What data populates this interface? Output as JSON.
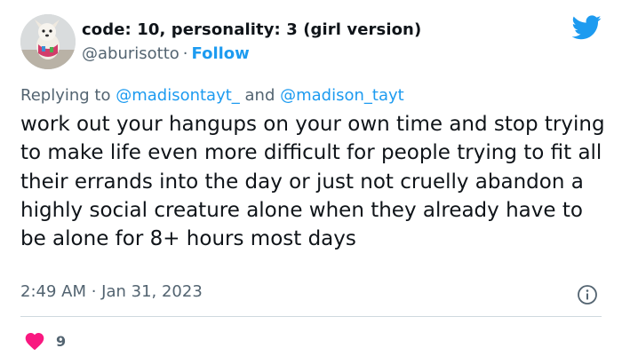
{
  "author": {
    "display_name": "code: 10, personality: 3 (girl version)",
    "handle": "@aburisotto",
    "separator": "·",
    "follow_label": "Follow"
  },
  "reply": {
    "prefix": "Replying to ",
    "mention_1": "@madisontayt_",
    "conjunction": " and ",
    "mention_2": "@madison_tayt"
  },
  "tweet": {
    "text": "work out your hangups on your own time and stop trying to make life even more difficult for people trying to fit all their errands into the day or just not cruelly abandon a highly social creature alone when they already have to be alone for 8+ hours most days",
    "timestamp": "2:49 AM · Jan 31, 2023"
  },
  "engagement": {
    "likes": "9"
  },
  "colors": {
    "accent": "#1d9bf0",
    "muted": "#536471",
    "heart": "#f91880"
  },
  "icons": {
    "brand": "twitter-bird-icon",
    "info": "info-icon",
    "like": "heart-icon"
  }
}
